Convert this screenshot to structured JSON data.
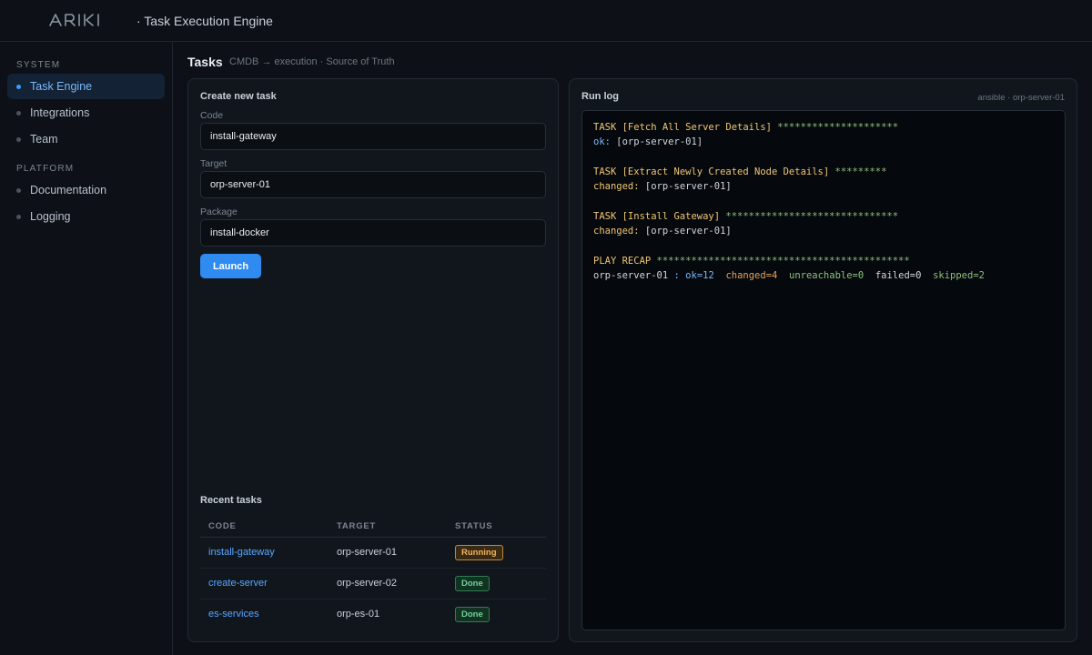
{
  "header": {
    "brand": "ARIKI",
    "app_title": "· Task Execution Engine"
  },
  "sidebar": {
    "sections": [
      {
        "label": "SYSTEM"
      },
      {
        "label": "PLATFORM"
      }
    ],
    "items": [
      {
        "label": "Task Engine",
        "active": true
      },
      {
        "label": "Integrations",
        "active": false
      },
      {
        "label": "Team",
        "active": false
      },
      {
        "label": "Documentation",
        "active": false
      },
      {
        "label": "Logging",
        "active": false
      }
    ]
  },
  "page": {
    "title": "Tasks",
    "breadcrumb": "CMDB → execution · Source of Truth"
  },
  "create_task": {
    "title": "Create new task",
    "fields": [
      {
        "label": "Code",
        "value": "install-gateway"
      },
      {
        "label": "Target",
        "value": "orp-server-01"
      },
      {
        "label": "Package",
        "value": "install-docker"
      }
    ],
    "launch_label": "Launch"
  },
  "recent_tasks": {
    "title": "Recent tasks",
    "columns": [
      "CODE",
      "TARGET",
      "STATUS"
    ],
    "rows": [
      {
        "code": "install-gateway",
        "target": "orp-server-01",
        "status": "Running"
      },
      {
        "code": "create-server",
        "target": "orp-server-02",
        "status": "Done"
      },
      {
        "code": "es-services",
        "target": "orp-es-01",
        "status": "Done"
      }
    ]
  },
  "run_log": {
    "title": "Run log",
    "meta": "ansible · orp-server-01",
    "lines": [
      "TASK [Fetch All Server Details] *********************",
      "ok: [orp-server-01]",
      "",
      "TASK [Extract Newly Created Node Details] *********",
      "changed: [orp-server-01]",
      "",
      "TASK [Install Gateway] ******************************",
      "changed: [orp-server-01]",
      "",
      "PLAY RECAP ********************************************",
      "orp-server-01 : ok=12  changed=4  unreachable=0  failed=0  skipped=2"
    ]
  },
  "colors": {
    "accent": "#2f8bf0",
    "link": "#58a6ff",
    "running": "#f0b560",
    "done": "#6fd39a",
    "background": "#0d1117"
  }
}
